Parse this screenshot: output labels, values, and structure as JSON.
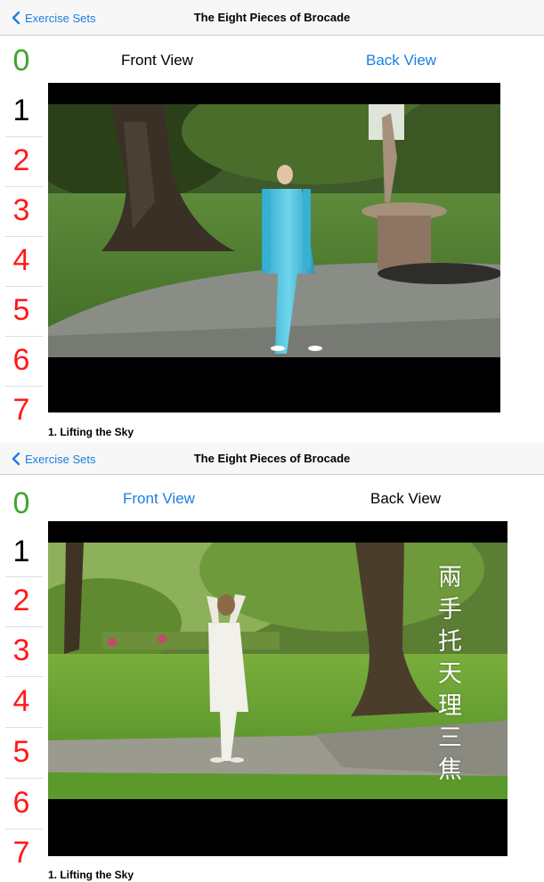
{
  "panels": [
    {
      "nav": {
        "back_label": "Exercise Sets",
        "title": "The Eight Pieces of Brocade"
      },
      "steps": [
        "0",
        "1",
        "2",
        "3",
        "4",
        "5",
        "6",
        "7"
      ],
      "view_buttons": {
        "front": "Front View",
        "back": "Back View",
        "selected": "front"
      },
      "caption": "1. Lifting the Sky",
      "video": {
        "view": "front",
        "overlay_text": []
      }
    },
    {
      "nav": {
        "back_label": "Exercise Sets",
        "title": "The Eight Pieces of Brocade"
      },
      "steps": [
        "0",
        "1",
        "2",
        "3",
        "4",
        "5",
        "6",
        "7"
      ],
      "view_buttons": {
        "front": "Front View",
        "back": "Back View",
        "selected": "back"
      },
      "caption": "1. Lifting the Sky",
      "video": {
        "view": "back",
        "overlay_text": [
          "兩",
          "手",
          "托",
          "天",
          "理",
          "三",
          "焦"
        ]
      }
    }
  ],
  "colors": {
    "link": "#1a7ee0",
    "step_zero": "#3fa52c",
    "step_selected": "#000000",
    "step_other": "#ff1a1a"
  }
}
